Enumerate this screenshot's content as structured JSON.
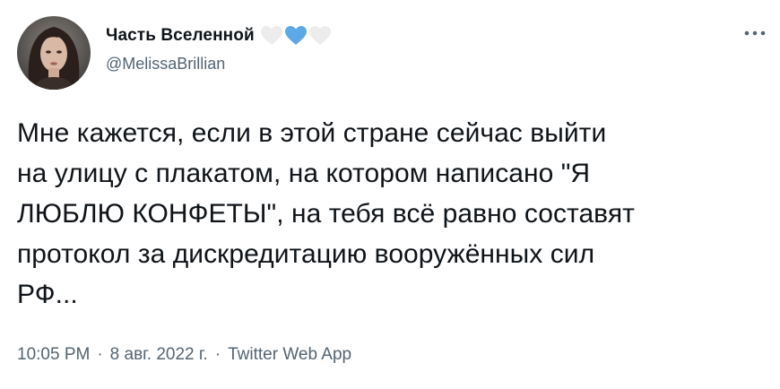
{
  "author": {
    "display_name": "Часть Вселенной",
    "handle": "@MelissaBrillian",
    "emoji": [
      "white-heart",
      "blue-heart",
      "white-heart"
    ]
  },
  "tweet": {
    "lines": [
      "Мне кажется, если в этой стране сейчас выйти",
      "на улицу с плакатом, на котором написано \"Я",
      "ЛЮБЛЮ КОНФЕТЫ\", на тебя всё равно составят",
      "протокол за дискредитацию вооружённых сил",
      "РФ..."
    ]
  },
  "meta": {
    "time": "10:05 PM",
    "separator": "·",
    "date": "8 авг. 2022 г.",
    "source": "Twitter Web App"
  },
  "colors": {
    "text": "#0f1419",
    "secondary": "#536471",
    "blue_heart": "#5da8e6",
    "white_heart": "#ececec"
  }
}
